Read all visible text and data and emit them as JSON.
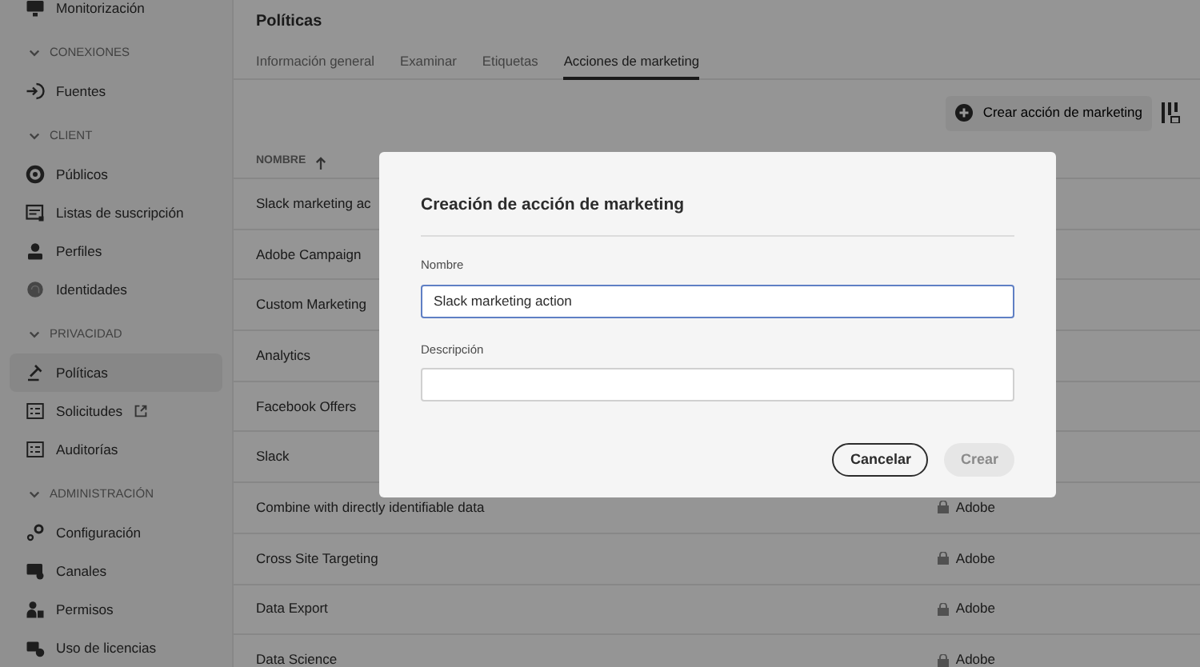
{
  "sidebar": {
    "top_items": [
      {
        "label": "Monitorización"
      }
    ],
    "groups": [
      {
        "title": "CONEXIONES",
        "expanded": true,
        "items": [
          {
            "label": "Fuentes",
            "selected": false
          }
        ]
      },
      {
        "title": "CLIENT",
        "expanded": true,
        "items": [
          {
            "label": "Públicos",
            "selected": false
          },
          {
            "label": "Listas de suscripción",
            "selected": false
          },
          {
            "label": "Perfiles",
            "selected": false
          },
          {
            "label": "Identidades",
            "selected": false
          }
        ]
      },
      {
        "title": "PRIVACIDAD",
        "expanded": true,
        "items": [
          {
            "label": "Políticas",
            "selected": true
          },
          {
            "label": "Solicitudes",
            "selected": false,
            "external": true
          },
          {
            "label": "Auditorías",
            "selected": false
          }
        ]
      },
      {
        "title": "ADMINISTRACIÓN",
        "expanded": true,
        "items": [
          {
            "label": "Configuración",
            "selected": false
          },
          {
            "label": "Canales",
            "selected": false
          },
          {
            "label": "Permisos",
            "selected": false
          },
          {
            "label": "Uso de licencias",
            "selected": false
          }
        ]
      }
    ]
  },
  "page": {
    "title": "Políticas",
    "tabs": [
      {
        "label": "Información general",
        "selected": false
      },
      {
        "label": "Examinar",
        "selected": false
      },
      {
        "label": "Etiquetas",
        "selected": false
      },
      {
        "label": "Acciones de marketing",
        "selected": true
      }
    ],
    "create_button": "Crear acción de marketing",
    "table": {
      "columns": [
        {
          "label": "NOMBRE",
          "sort_ascending": true
        }
      ],
      "rows": [
        {
          "name": "Slack marketing ac"
        },
        {
          "name": "Adobe Campaign"
        },
        {
          "name": "Custom Marketing"
        },
        {
          "name": "Analytics"
        },
        {
          "name": "Facebook Offers"
        },
        {
          "name": "Slack"
        },
        {
          "name": "Combine with directly identifiable data",
          "source": "Adobe"
        },
        {
          "name": "Cross Site Targeting",
          "source": "Adobe"
        },
        {
          "name": "Data Export",
          "source": "Adobe"
        },
        {
          "name": "Data Science",
          "source": "Adobe"
        }
      ]
    }
  },
  "dialog": {
    "title": "Creación de acción de marketing",
    "fields": [
      {
        "label": "Nombre",
        "value": "Slack marketing action",
        "focused": true
      },
      {
        "label": "Descripción",
        "focused": false
      }
    ],
    "buttons": [
      {
        "label": "Cancelar",
        "kind": "secondary",
        "disabled": false
      },
      {
        "label": "Crear",
        "kind": "primary",
        "disabled": true
      }
    ]
  }
}
